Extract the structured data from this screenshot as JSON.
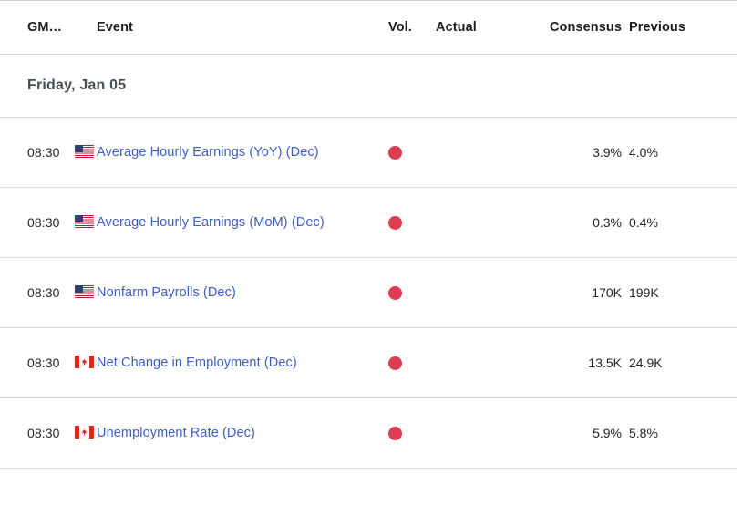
{
  "table": {
    "headers": {
      "gmt": "GM…",
      "event": "Event",
      "vol": "Vol.",
      "actual": "Actual",
      "consensus": "Consensus",
      "previous": "Previous"
    },
    "date_group": "Friday, Jan 05",
    "rows": [
      {
        "time": "08:30",
        "country": "United States",
        "flag": "us",
        "event": "Average Hourly Earnings (YoY) (Dec)",
        "volatility": "high",
        "volatility_icon": "red-dot-icon",
        "actual": "",
        "consensus": "3.9%",
        "previous": "4.0%"
      },
      {
        "time": "08:30",
        "country": "United States",
        "flag": "us",
        "event": "Average Hourly Earnings (MoM) (Dec)",
        "volatility": "high",
        "volatility_icon": "red-dot-icon",
        "actual": "",
        "consensus": "0.3%",
        "previous": "0.4%"
      },
      {
        "time": "08:30",
        "country": "United States",
        "flag": "us",
        "event": "Nonfarm Payrolls (Dec)",
        "volatility": "high",
        "volatility_icon": "red-dot-icon",
        "actual": "",
        "consensus": "170K",
        "previous": "199K"
      },
      {
        "time": "08:30",
        "country": "Canada",
        "flag": "ca",
        "event": "Net Change in Employment (Dec)",
        "volatility": "high",
        "volatility_icon": "red-dot-icon",
        "actual": "",
        "consensus": "13.5K",
        "previous": "24.9K"
      },
      {
        "time": "08:30",
        "country": "Canada",
        "flag": "ca",
        "event": "Unemployment Rate (Dec)",
        "volatility": "high",
        "volatility_icon": "red-dot-icon",
        "actual": "",
        "consensus": "5.9%",
        "previous": "5.8%"
      }
    ]
  },
  "colors": {
    "link": "#3d5ec0",
    "volatility_high": "#dc3d4f",
    "text": "#21262b",
    "date_text": "#4a4f54",
    "divider": "#d8dce0",
    "background": "#ffffff"
  }
}
